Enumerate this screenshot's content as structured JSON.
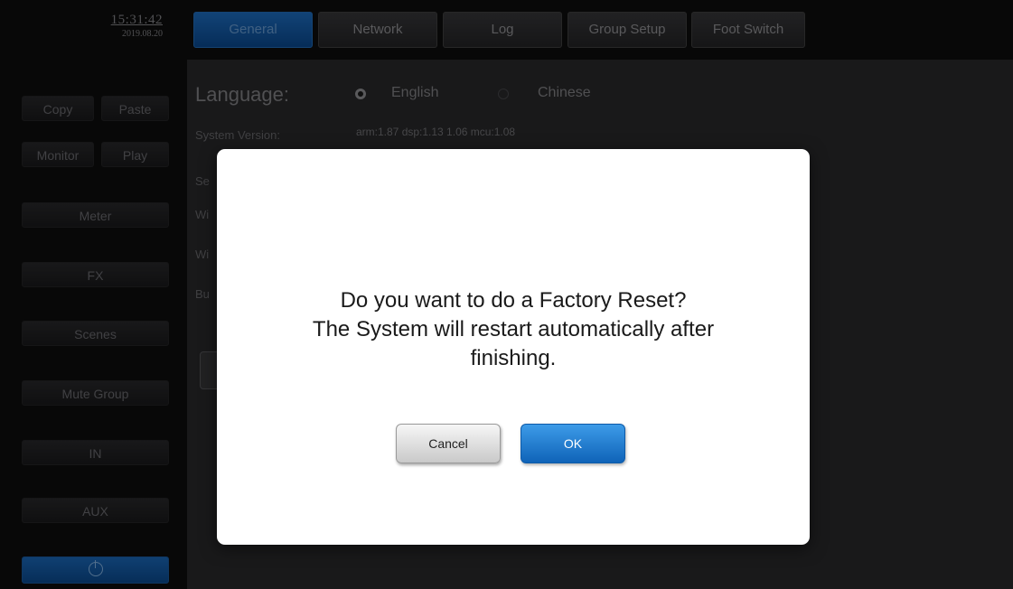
{
  "clock": {
    "time": "15:31:42",
    "date": "2019.08.20"
  },
  "sidebar": {
    "copy": "Copy",
    "paste": "Paste",
    "monitor": "Monitor",
    "play": "Play",
    "meter": "Meter",
    "fx": "FX",
    "scenes": "Scenes",
    "mute_group": "Mute Group",
    "in": "IN",
    "aux": "AUX",
    "power_icon": "power-icon"
  },
  "tabs": [
    "General",
    "Network",
    "Log",
    "Group Setup",
    "Foot Switch"
  ],
  "active_tab": "General",
  "general": {
    "language_label": "Language:",
    "language_options": [
      "English",
      "Chinese"
    ],
    "language_selected": "English",
    "system_version_label": "System Version:",
    "system_version_value": "arm:1.87 dsp:1.13 1.06 mcu:1.08",
    "partial_labels": [
      "Se",
      "Wi",
      "Wi",
      "Bu"
    ]
  },
  "dialog": {
    "line1": "Do you want to do a Factory Reset?",
    "line2": "The System will restart automatically after",
    "line3": "finishing.",
    "cancel_label": "Cancel",
    "ok_label": "OK"
  },
  "colors": {
    "accent": "#1a6ec2",
    "dialog_bg": "#ffffff",
    "app_bg": "#2a2a2c"
  }
}
